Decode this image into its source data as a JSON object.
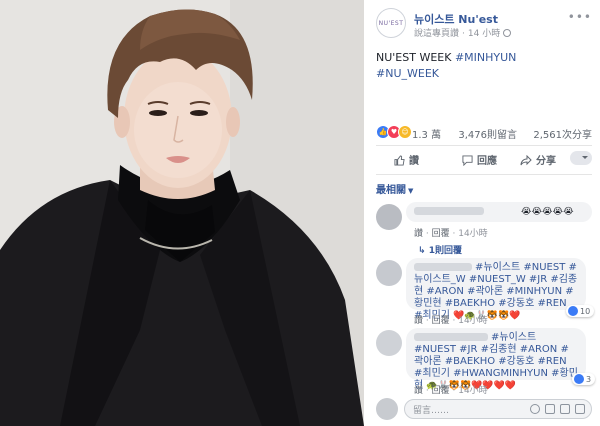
{
  "header": {
    "avatar_text": "NU'EST",
    "page_name": "뉴이스트 Nu'est",
    "sub_label": "說這專頁讚",
    "time": "14 小時"
  },
  "post": {
    "text_plain": "NU'EST WEEK ",
    "tag1": "#MINHYUN",
    "tag2": "#NU_WEEK"
  },
  "stats": {
    "reactions": "1.3 萬",
    "comments": "3,476則留言",
    "shares": "2,561次分享"
  },
  "actions": {
    "like": "讚",
    "comment": "回應",
    "share": "分享"
  },
  "filter": {
    "label": "最相關"
  },
  "comments": [
    {
      "text": "😭😭😭😭😭",
      "like": "讚",
      "reply": "回覆",
      "time": "14小時"
    },
    {
      "reply_count": "1則回覆"
    },
    {
      "text": "#뉴이스트 #NUEST #뉴이스트_W #NUEST_W #JR #김종현 #ARON #곽아론 #MINHYUN #황민현 #BAEKHO #강동호 #REN #최민기",
      "emoji": "❤️🐢🐰🐯🐯❤️",
      "like": "讚",
      "reply": "回覆",
      "time": "14小時",
      "likes": "10"
    },
    {
      "text": "#뉴이스트 #NUEST #JR #김종현 #ARON #곽아론 #BAEKHO #강동호 #REN #최민기 #HWANGMINHYUN #황민현",
      "emoji": "🐢🐰🐯🐯❤️❤️❤️❤️",
      "like": "讚",
      "reply": "回覆",
      "time": "14小時",
      "likes": "3"
    }
  ],
  "composer": {
    "placeholder": "留言……"
  },
  "more_icon": "ellipsis-icon",
  "colors": {
    "link": "#365899",
    "like_blue": "#3b7bf6",
    "bg_dark": "#000000"
  }
}
